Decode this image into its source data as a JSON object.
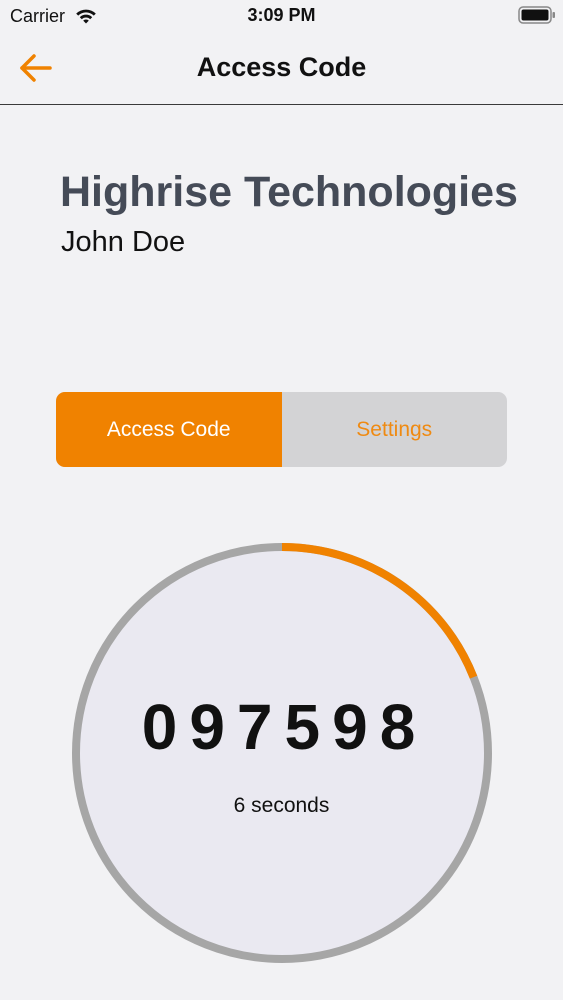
{
  "status_bar": {
    "carrier": "Carrier",
    "time": "3:09 PM",
    "icons": [
      "wifi-icon",
      "battery-icon"
    ]
  },
  "nav": {
    "title": "Access Code",
    "back_icon": "arrow-left-icon"
  },
  "account": {
    "company": "Highrise Technologies",
    "user": "John Doe"
  },
  "tabs": [
    {
      "label": "Access Code",
      "selected": true
    },
    {
      "label": "Settings",
      "selected": false
    }
  ],
  "timer": {
    "code": "097598",
    "remaining_label": "6 seconds",
    "elapsed_fraction": 0.19
  },
  "colors": {
    "accent": "#f08200",
    "ring_track": "#a6a6a6",
    "ring_fill": "#eae9f1",
    "title_gray": "#454b57",
    "background": "#f2f2f4"
  }
}
